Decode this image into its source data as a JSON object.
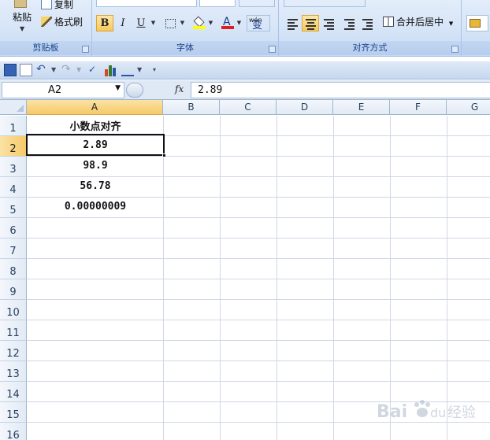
{
  "ribbon": {
    "clipboard": {
      "paste_label": "粘贴",
      "copy_label": "复制",
      "format_painter_label": "格式刷",
      "group_label": "剪贴板"
    },
    "font": {
      "bold_label": "B",
      "italic_label": "I",
      "underline_label": "U",
      "font_color_label": "A",
      "phonetic_label": "wén",
      "phonetic_char": "变",
      "group_label": "字体"
    },
    "alignment": {
      "merge_center_label": "合并后居中",
      "group_label": "对齐方式"
    }
  },
  "formula_bar": {
    "name_box": "A2",
    "fx_label": "fx",
    "value": "2.89"
  },
  "grid": {
    "columns": [
      "A",
      "B",
      "C",
      "D",
      "E",
      "F",
      "G"
    ],
    "rows": [
      "1",
      "2",
      "3",
      "4",
      "5",
      "6",
      "7",
      "8",
      "9",
      "10",
      "11",
      "12",
      "13",
      "14",
      "15",
      "16"
    ],
    "selected_cell": "A2",
    "cells": {
      "A1": "小数点对齐",
      "A2": "2.89",
      "A3": "98.9",
      "A4": "56.78",
      "A5": "0.00000009"
    }
  },
  "watermark": {
    "text_bai": "Bai",
    "text_du": "du",
    "text_jingyan": "经验"
  },
  "colors": {
    "ribbon_bg": "#d5e4f7",
    "selection_header": "#f6c967",
    "grid_line": "#d0d7e5",
    "header_text": "#27415f"
  }
}
